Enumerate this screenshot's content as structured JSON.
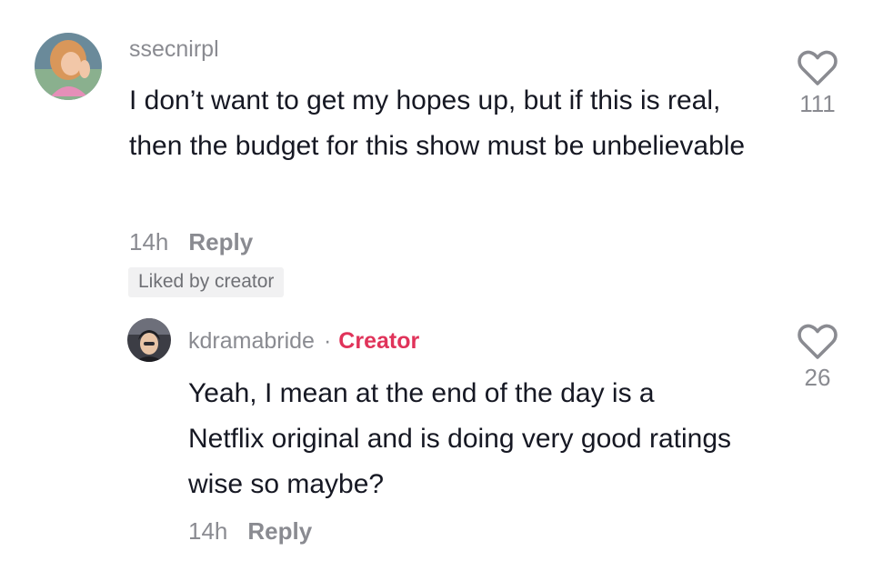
{
  "comments": [
    {
      "username": "ssecnirpl",
      "text": "I don’t want to get my hopes up, but if this is real, then the budget for this show must be unbelievable",
      "time": "14h",
      "reply_label": "Reply",
      "badge": "Liked by creator",
      "like_count": "111",
      "icon": "heart-outline-icon"
    }
  ],
  "reply": {
    "username": "kdramabride",
    "separator": "·",
    "creator_label": "Creator",
    "text": "Yeah, I mean at the end of the day is a Netflix original and is doing very good ratings wise so maybe?",
    "time": "14h",
    "reply_label": "Reply",
    "like_count": "26",
    "icon": "heart-outline-icon"
  },
  "colors": {
    "secondary_text": "#8a8b91",
    "primary_text": "#161823",
    "creator_accent": "#e0335a",
    "badge_bg": "#f1f1f2"
  }
}
